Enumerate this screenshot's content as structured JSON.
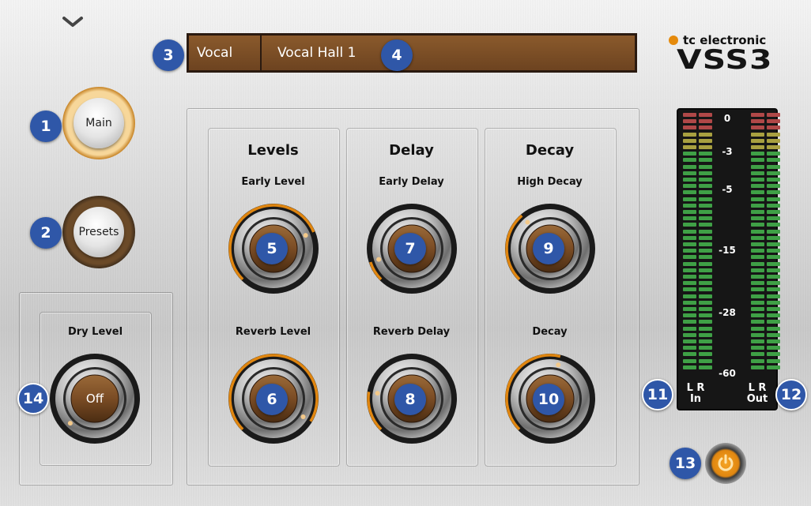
{
  "app": {
    "brand_small": "tc electronic",
    "brand_large": "VSS3"
  },
  "preset": {
    "category": "Vocal",
    "name": "Vocal Hall 1"
  },
  "nav": {
    "main_label": "Main",
    "presets_label": "Presets"
  },
  "sections": {
    "levels": "Levels",
    "delay": "Delay",
    "decay": "Decay"
  },
  "knobs": {
    "early_level": {
      "label": "Early Level",
      "value": "",
      "level": 0.75
    },
    "reverb_level": {
      "label": "Reverb Level",
      "value": "",
      "level": 0.95
    },
    "early_delay": {
      "label": "Early Delay",
      "value": "",
      "level": 0.1
    },
    "reverb_delay": {
      "label": "Reverb Delay",
      "value": "",
      "level": 0.2
    },
    "high_decay": {
      "label": "High Decay",
      "value": "",
      "level": 0.35
    },
    "decay": {
      "label": "Decay",
      "value": "",
      "level": 0.55
    },
    "dry_level": {
      "label": "Dry Level",
      "value": "Off",
      "level": 0.0
    }
  },
  "meter": {
    "scale": [
      "0",
      "-3",
      "-5",
      "-15",
      "-28",
      "-60"
    ],
    "in_channels": "L R",
    "in_label": "In",
    "out_channels": "L R",
    "out_label": "Out"
  },
  "badges": [
    "1",
    "2",
    "3",
    "4",
    "5",
    "6",
    "7",
    "8",
    "9",
    "10",
    "11",
    "12",
    "13",
    "14"
  ],
  "colors": {
    "accent": "#e08610",
    "badge": "#2f57a8",
    "display_brown": "#7a4c24"
  },
  "icons": {
    "collapse": "chevron-down-icon",
    "power": "power-icon"
  }
}
